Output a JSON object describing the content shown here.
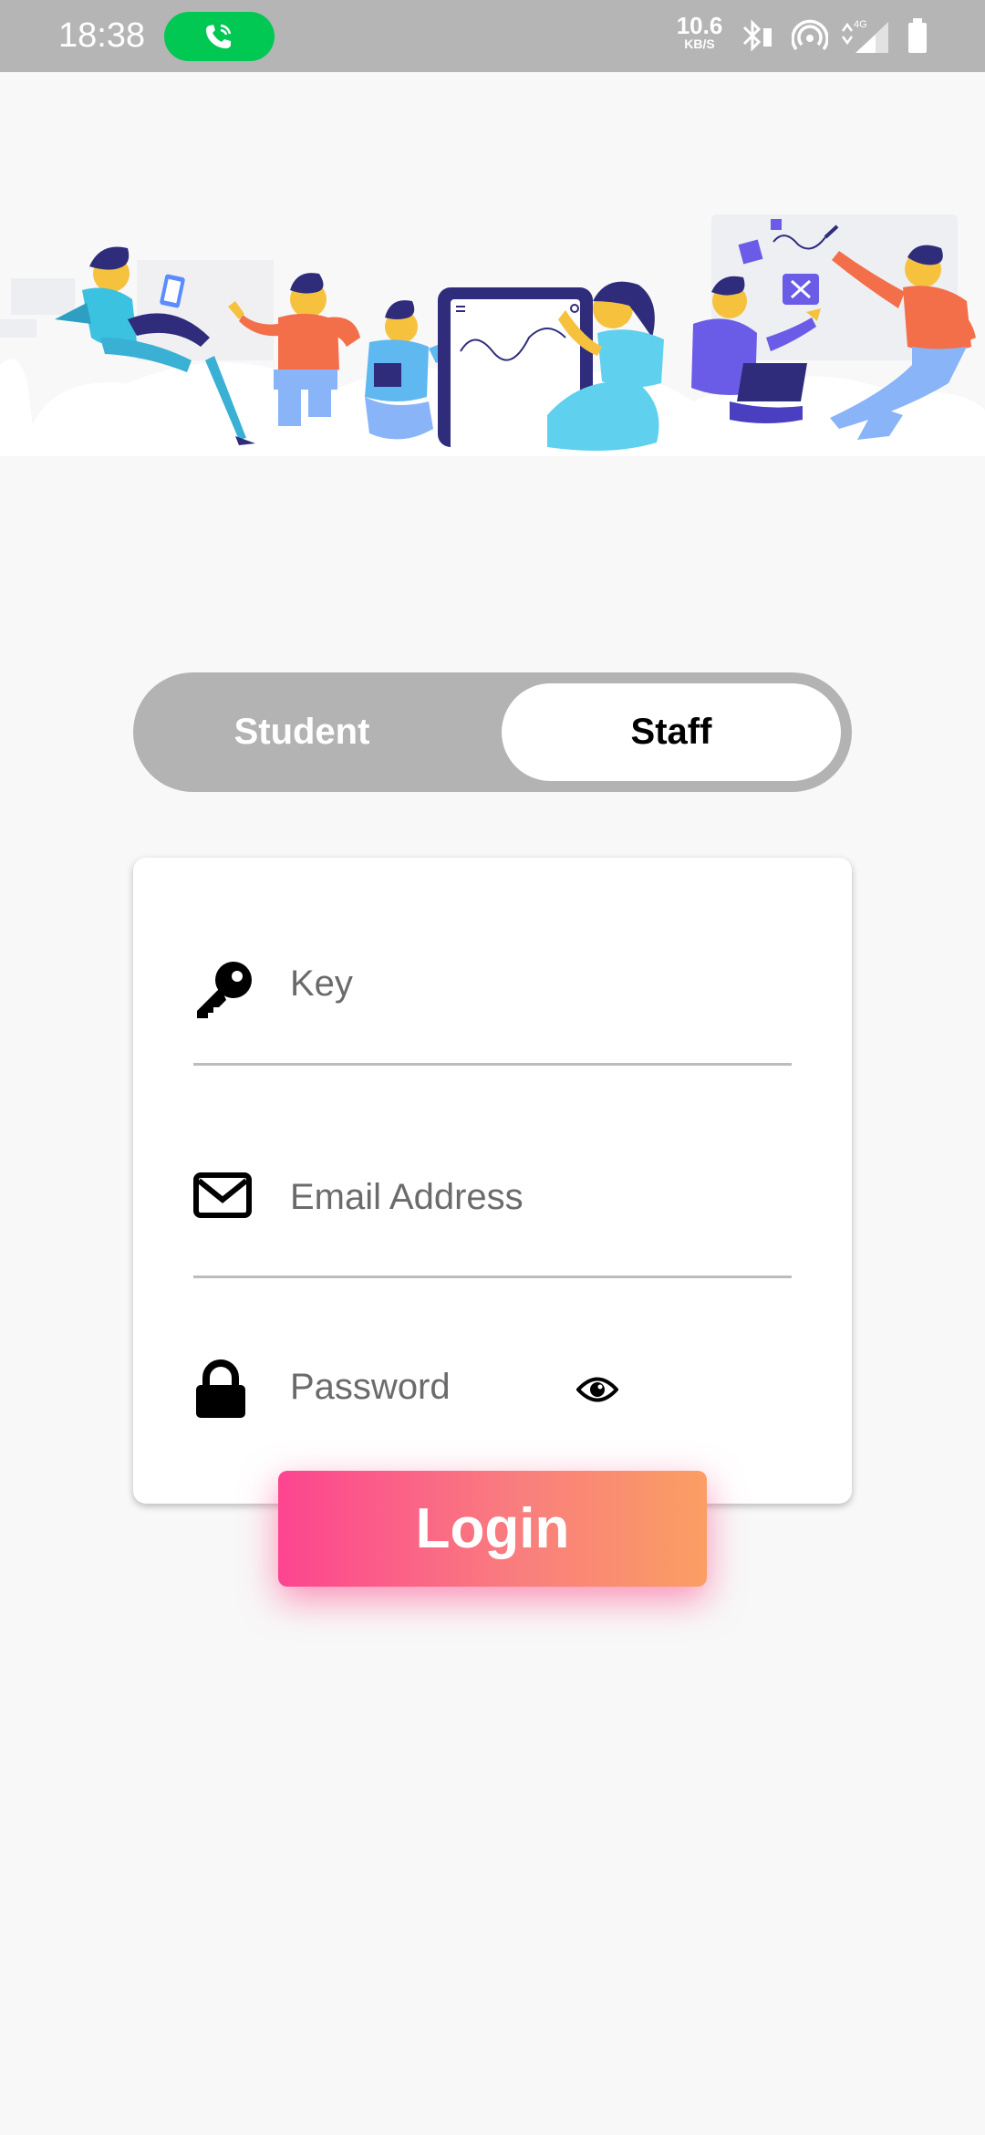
{
  "status_bar": {
    "time": "18:38",
    "net_speed": "10.6",
    "net_unit": "KB/S",
    "network": "4G"
  },
  "toggle": {
    "options": [
      "Student",
      "Staff"
    ],
    "selected": "Staff"
  },
  "form": {
    "key_placeholder": "Key",
    "email_placeholder": "Email Address",
    "password_placeholder": "Password"
  },
  "login_label": "Login",
  "colors": {
    "status_bar": "#b5b5b5",
    "call_pill": "#00c853",
    "toggle_track": "#b3b3b3",
    "login_gradient_start": "#fd4490",
    "login_gradient_end": "#fb9e63"
  },
  "icons": [
    "phone-icon",
    "bluetooth-icon",
    "hotspot-icon",
    "signal-icon",
    "battery-icon",
    "key-icon",
    "envelope-icon",
    "lock-icon",
    "eye-icon"
  ]
}
